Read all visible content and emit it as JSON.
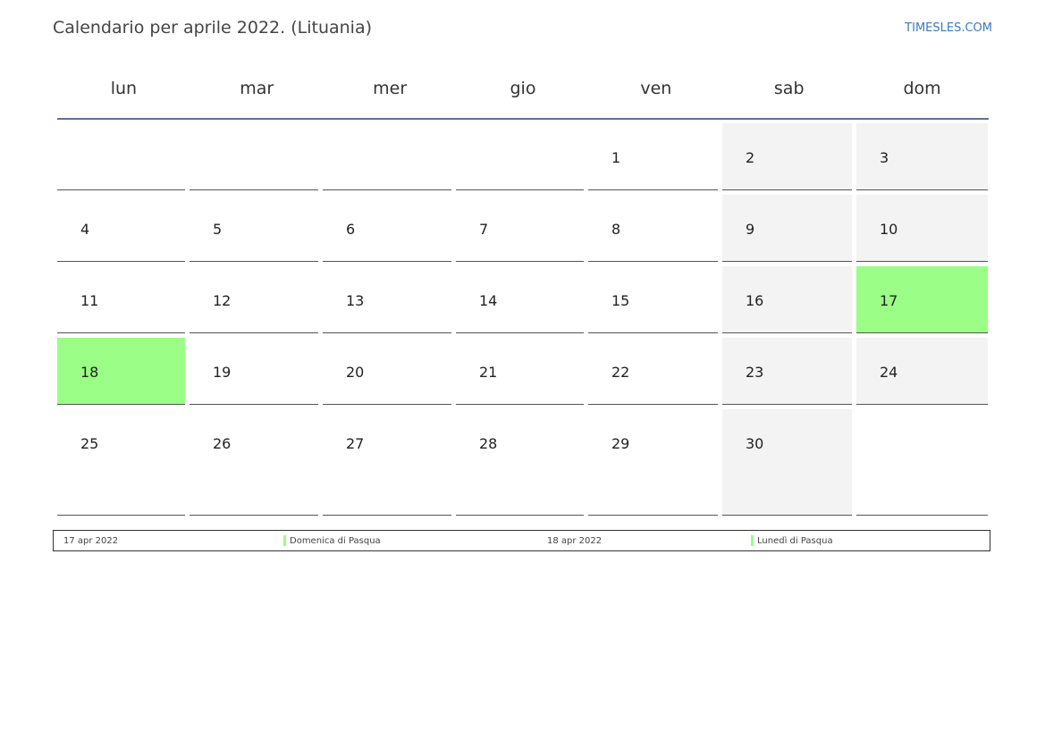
{
  "header": {
    "title": "Calendario per aprile 2022. (Lituania)",
    "brand": "TIMESLES.COM"
  },
  "weekdays": [
    "lun",
    "mar",
    "mer",
    "gio",
    "ven",
    "sab",
    "dom"
  ],
  "weeks": [
    [
      {
        "day": "",
        "type": "normal"
      },
      {
        "day": "",
        "type": "normal"
      },
      {
        "day": "",
        "type": "normal"
      },
      {
        "day": "",
        "type": "normal"
      },
      {
        "day": "1",
        "type": "normal"
      },
      {
        "day": "2",
        "type": "weekend"
      },
      {
        "day": "3",
        "type": "weekend"
      }
    ],
    [
      {
        "day": "4",
        "type": "normal"
      },
      {
        "day": "5",
        "type": "normal"
      },
      {
        "day": "6",
        "type": "normal"
      },
      {
        "day": "7",
        "type": "normal"
      },
      {
        "day": "8",
        "type": "normal"
      },
      {
        "day": "9",
        "type": "weekend"
      },
      {
        "day": "10",
        "type": "weekend"
      }
    ],
    [
      {
        "day": "11",
        "type": "normal"
      },
      {
        "day": "12",
        "type": "normal"
      },
      {
        "day": "13",
        "type": "normal"
      },
      {
        "day": "14",
        "type": "normal"
      },
      {
        "day": "15",
        "type": "normal"
      },
      {
        "day": "16",
        "type": "weekend"
      },
      {
        "day": "17",
        "type": "holiday"
      }
    ],
    [
      {
        "day": "18",
        "type": "holiday"
      },
      {
        "day": "19",
        "type": "normal"
      },
      {
        "day": "20",
        "type": "normal"
      },
      {
        "day": "21",
        "type": "normal"
      },
      {
        "day": "22",
        "type": "normal"
      },
      {
        "day": "23",
        "type": "weekend"
      },
      {
        "day": "24",
        "type": "weekend"
      }
    ],
    [
      {
        "day": "25",
        "type": "normal"
      },
      {
        "day": "26",
        "type": "normal"
      },
      {
        "day": "27",
        "type": "normal"
      },
      {
        "day": "28",
        "type": "normal"
      },
      {
        "day": "29",
        "type": "normal"
      },
      {
        "day": "30",
        "type": "weekend"
      },
      {
        "day": "",
        "type": "normal"
      }
    ]
  ],
  "legend": [
    {
      "date": "17 apr 2022",
      "name": "Domenica di Pasqua"
    },
    {
      "date": "18 apr 2022",
      "name": "Lunedì di Pasqua"
    }
  ],
  "colors": {
    "holiday": "#9afe87",
    "weekend": "#f3f3f3",
    "header_rule": "#5b7394",
    "brand": "#3a7bbf"
  }
}
